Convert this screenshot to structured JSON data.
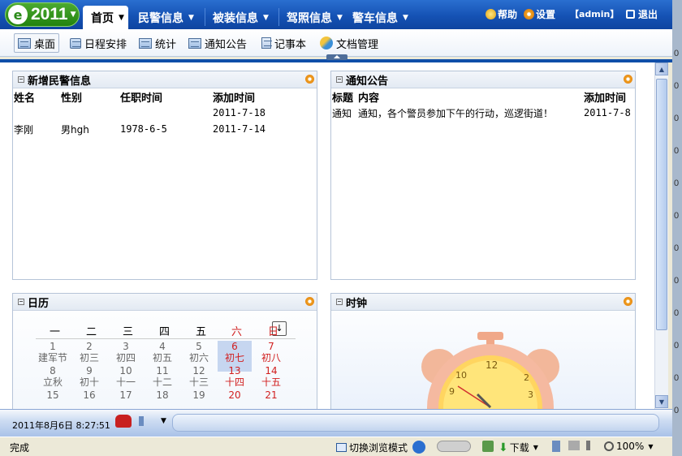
{
  "logo": {
    "year": "2011"
  },
  "nav": {
    "items": [
      {
        "label": "首页"
      },
      {
        "label": "民警信息"
      },
      {
        "label": "被装信息"
      },
      {
        "label": "驾照信息"
      },
      {
        "label": "警车信息"
      }
    ],
    "help": "帮助",
    "settings": "设置",
    "user": "【admin】",
    "logout": "退出"
  },
  "subnav": {
    "items": [
      {
        "label": "桌面"
      },
      {
        "label": "日程安排"
      },
      {
        "label": "统计"
      },
      {
        "label": "通知公告"
      },
      {
        "label": "记事本"
      },
      {
        "label": "文档管理"
      }
    ]
  },
  "panels": {
    "police": {
      "title": "新增民警信息",
      "columns": [
        "姓名",
        "性别",
        "任职时间",
        "添加时间"
      ],
      "rows": [
        [
          "",
          "",
          "",
          "2011-7-18"
        ],
        [
          "李刚",
          "男hgh",
          "1978-6-5",
          "2011-7-14"
        ]
      ]
    },
    "notice": {
      "title": "通知公告",
      "columns": [
        "标题",
        "内容",
        "添加时间"
      ],
      "rows": [
        [
          "通知",
          "通知，各个警员参加下午的行动，巡逻街道！",
          "2011-7-8"
        ]
      ]
    },
    "calendar": {
      "title": "日历",
      "weekdays": [
        "一",
        "二",
        "三",
        "四",
        "五",
        "六",
        "日"
      ],
      "weeks": [
        [
          [
            "1",
            "建军节"
          ],
          [
            "2",
            "初三"
          ],
          [
            "3",
            "初四"
          ],
          [
            "4",
            "初五"
          ],
          [
            "5",
            "初六"
          ],
          [
            "6",
            "初七"
          ],
          [
            "7",
            "初八"
          ]
        ],
        [
          [
            "8",
            "立秋"
          ],
          [
            "9",
            "初十"
          ],
          [
            "10",
            "十一"
          ],
          [
            "11",
            "十二"
          ],
          [
            "12",
            "十三"
          ],
          [
            "13",
            "十四"
          ],
          [
            "14",
            "十五"
          ]
        ],
        [
          [
            "15",
            ""
          ],
          [
            "16",
            ""
          ],
          [
            "17",
            ""
          ],
          [
            "18",
            ""
          ],
          [
            "19",
            ""
          ],
          [
            "20",
            ""
          ],
          [
            "21",
            ""
          ]
        ]
      ],
      "today_index": [
        0,
        5
      ]
    },
    "clock": {
      "title": "时钟"
    }
  },
  "taskbar": {
    "datetime": "2011年8月6日  8:27:51"
  },
  "statusbar": {
    "status": "完成",
    "browse_mode": "切换浏览模式",
    "download": "下载",
    "zoom": "100%"
  }
}
